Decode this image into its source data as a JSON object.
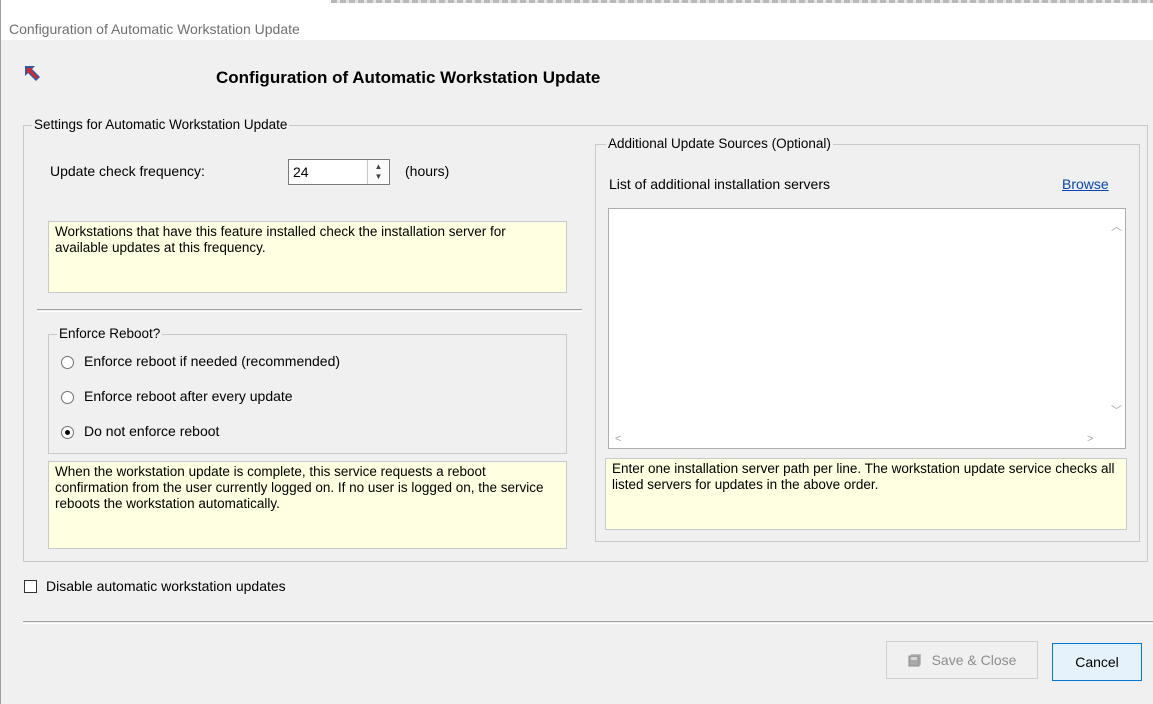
{
  "window": {
    "title": "Configuration of Automatic Workstation Update"
  },
  "header": {
    "title": "Configuration of Automatic Workstation Update",
    "icon": "app-arrow-icon"
  },
  "settings": {
    "group_title": "Settings for Automatic Workstation Update",
    "frequency_label": "Update check frequency:",
    "frequency_value": "24",
    "frequency_unit": "(hours)",
    "frequency_note": "Workstations that have this feature installed check the installation server for available updates at this frequency.",
    "reboot": {
      "group_title": "Enforce Reboot?",
      "options": [
        {
          "label": "Enforce reboot if needed (recommended)",
          "checked": false
        },
        {
          "label": "Enforce reboot after every update",
          "checked": false
        },
        {
          "label": "Do not enforce reboot",
          "checked": true
        }
      ],
      "note": "When the workstation update is complete, this service requests a reboot confirmation from the user currently logged on. If no user is logged on, the service reboots the workstation automatically."
    }
  },
  "sources": {
    "group_title": "Additional Update Sources (Optional)",
    "list_label": "List of additional installation servers",
    "browse_link": "Browse",
    "list_value": "",
    "note": "Enter one installation server path per line.  The workstation update service checks all listed servers for updates in the above order."
  },
  "disable_checkbox": {
    "label": "Disable automatic workstation updates",
    "checked": false
  },
  "buttons": {
    "save_label": "Save & Close",
    "cancel_label": "Cancel"
  },
  "colors": {
    "note_background": "#ffffe1",
    "link": "#0645ad",
    "window_background": "#f0f0f0"
  }
}
